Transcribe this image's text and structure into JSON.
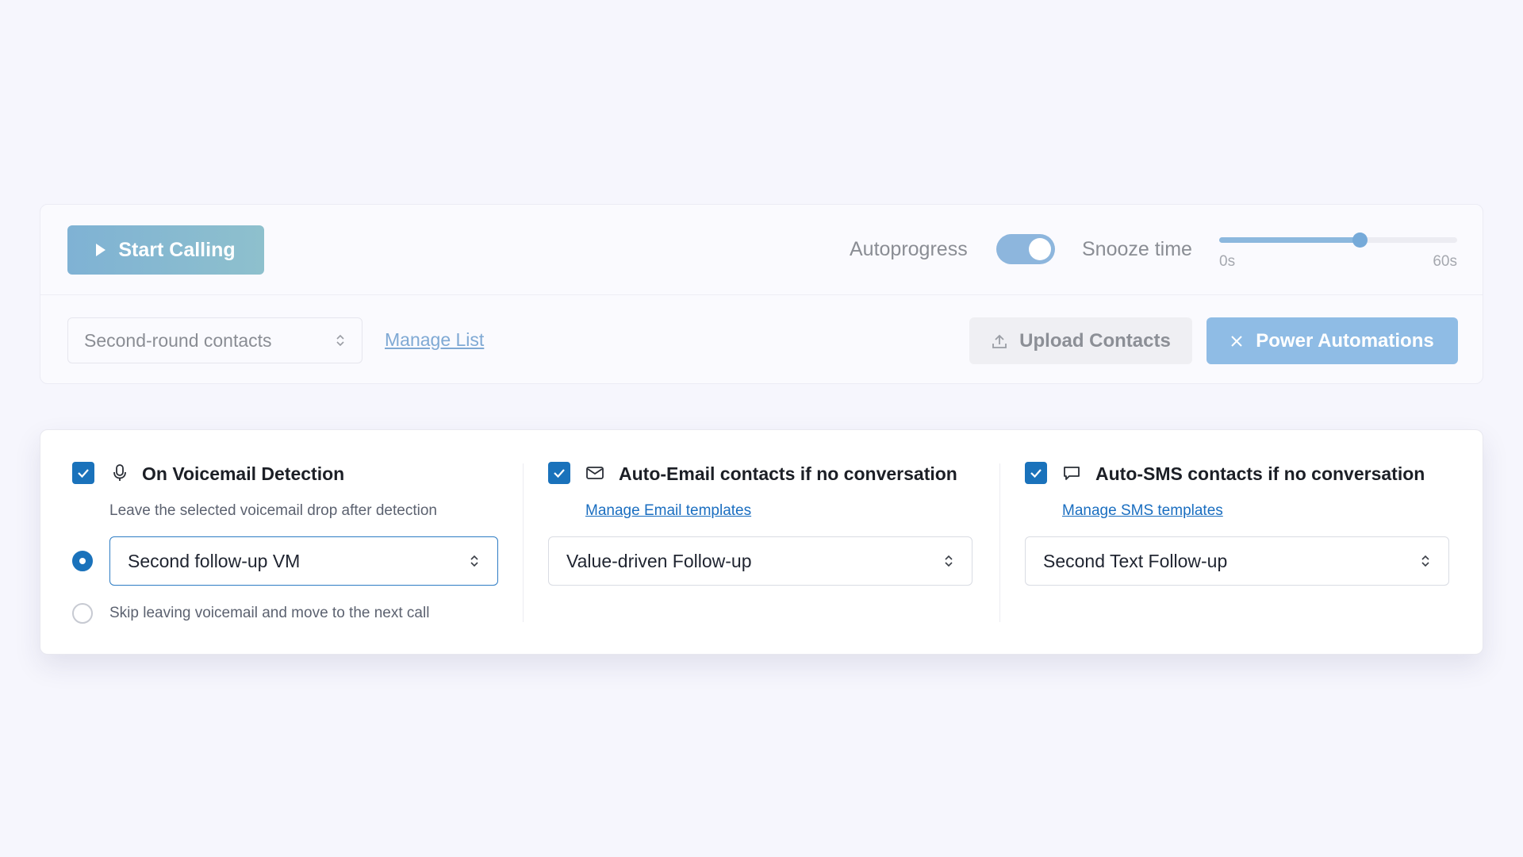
{
  "dialer": {
    "start_label": "Start Calling",
    "autoprogress_label": "Autoprogress",
    "autoprogress_on": true,
    "snooze_label": "Snooze time",
    "snooze_min_label": "0s",
    "snooze_max_label": "60s",
    "snooze_fraction": 0.59,
    "list_value": "Second-round contacts",
    "manage_list_label": "Manage List",
    "upload_label": "Upload Contacts",
    "power_label": "Power Automations"
  },
  "automations": {
    "voicemail": {
      "checked": true,
      "title": "On Voicemail Detection",
      "description": "Leave the selected voicemail drop after detection",
      "selected_drop": "Second follow-up VM",
      "skip_label": "Skip leaving voicemail and move to the next call",
      "selected_option": "drop"
    },
    "email": {
      "checked": true,
      "title": "Auto-Email contacts if no conversation",
      "link_label": "Manage Email templates",
      "selected_template": "Value-driven Follow-up"
    },
    "sms": {
      "checked": true,
      "title": "Auto-SMS contacts if no conversation",
      "link_label": "Manage SMS templates",
      "selected_template": "Second Text Follow-up"
    }
  },
  "colors": {
    "accent": "#1a72bb",
    "page_bg": "#f6f6fd",
    "dimmed_accent": "#8fbce5"
  },
  "icons": [
    "play-icon",
    "chevron-updown-icon",
    "upload-icon",
    "close-icon",
    "check-icon",
    "microphone-icon",
    "mail-icon",
    "chat-bubble-icon"
  ]
}
